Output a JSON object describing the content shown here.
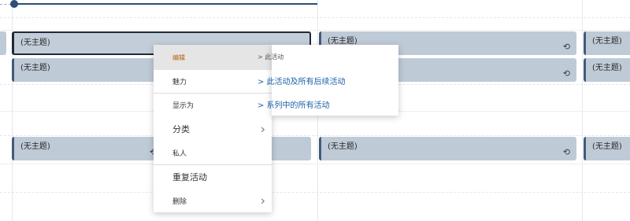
{
  "calendar": {
    "event_title": "(无主题)",
    "repeat_icon": "repeat-icon",
    "colors": {
      "event_fill": "#bfcad7",
      "event_bar": "#405b7a",
      "now_line": "#2d4e76"
    }
  },
  "context_menu": {
    "items": [
      {
        "label": "编辑",
        "has_submenu": false
      },
      {
        "label": "魅力",
        "has_submenu": false
      },
      {
        "label": "显示为",
        "has_submenu": false
      },
      {
        "label": "分类",
        "has_submenu": true
      },
      {
        "label": "私人",
        "has_submenu": false
      },
      {
        "label": "重复活动",
        "has_submenu": false
      },
      {
        "label": "删除",
        "has_submenu": true
      }
    ]
  },
  "submenu": {
    "items": [
      {
        "label": "> 此活动"
      },
      {
        "label": "> 此活动及所有后续活动"
      },
      {
        "label": "> 系列中的所有活动"
      }
    ]
  }
}
